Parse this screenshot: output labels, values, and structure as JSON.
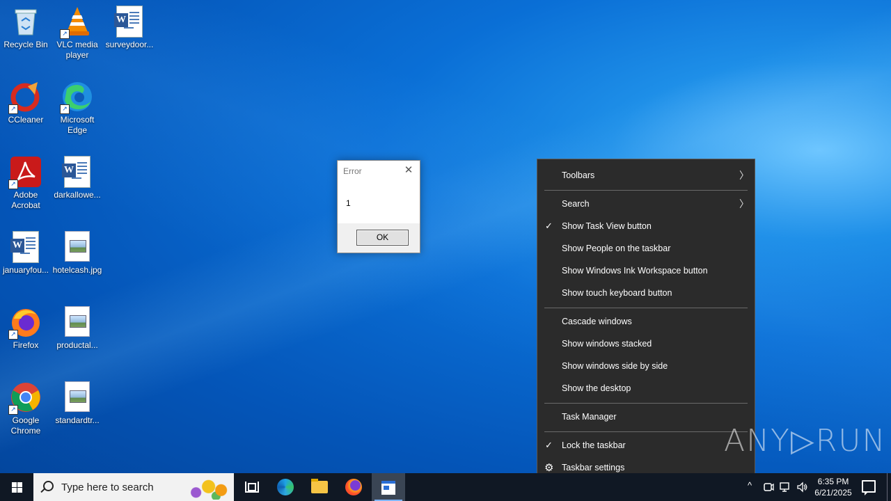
{
  "desktop_icons": [
    {
      "label": "Recycle Bin",
      "icon": "recycle-bin-icon"
    },
    {
      "label": "VLC media player",
      "icon": "vlc-icon"
    },
    {
      "label": "surveydoor...",
      "icon": "word-document-icon"
    },
    {
      "label": "CCleaner",
      "icon": "ccleaner-icon"
    },
    {
      "label": "Microsoft Edge",
      "icon": "edge-icon"
    },
    {
      "label": "Adobe Acrobat",
      "icon": "acrobat-icon"
    },
    {
      "label": "darkallowe...",
      "icon": "word-document-icon"
    },
    {
      "label": "januaryfou...",
      "icon": "word-document-icon"
    },
    {
      "label": "hotelcash.jpg",
      "icon": "image-file-icon"
    },
    {
      "label": "Firefox",
      "icon": "firefox-icon"
    },
    {
      "label": "productal...",
      "icon": "image-file-icon"
    },
    {
      "label": "Google Chrome",
      "icon": "chrome-icon"
    },
    {
      "label": "standardtr...",
      "icon": "image-file-icon"
    }
  ],
  "dialog": {
    "title": "Error",
    "close_symbol": "✕",
    "message": "1",
    "ok_label": "OK"
  },
  "context_menu": {
    "items": [
      {
        "label": "Toolbars",
        "checked": false,
        "submenu": true
      },
      {
        "label": "Search",
        "checked": false,
        "submenu": true
      },
      {
        "label": "Show Task View button",
        "checked": true,
        "submenu": false
      },
      {
        "label": "Show People on the taskbar",
        "checked": false,
        "submenu": false
      },
      {
        "label": "Show Windows Ink Workspace button",
        "checked": false,
        "submenu": false
      },
      {
        "label": "Show touch keyboard button",
        "checked": false,
        "submenu": false
      },
      {
        "label": "Cascade windows",
        "checked": false,
        "submenu": false
      },
      {
        "label": "Show windows stacked",
        "checked": false,
        "submenu": false
      },
      {
        "label": "Show windows side by side",
        "checked": false,
        "submenu": false
      },
      {
        "label": "Show the desktop",
        "checked": false,
        "submenu": false
      },
      {
        "label": "Task Manager",
        "checked": false,
        "submenu": false
      },
      {
        "label": "Lock the taskbar",
        "checked": true,
        "submenu": false
      },
      {
        "label": "Taskbar settings",
        "checked": false,
        "submenu": false,
        "icon": "gear-icon"
      }
    ],
    "check_symbol": "✓",
    "arrow_symbol": "〉"
  },
  "taskbar": {
    "search_placeholder": "Type here to search",
    "time": "6:35 PM",
    "date": "6/21/2025",
    "pinned": [
      "task-view-icon",
      "edge-icon",
      "file-explorer-icon",
      "firefox-icon",
      "active-window-icon"
    ],
    "tray_arrow": "^",
    "tray_icons": [
      "meet-now-icon",
      "network-icon",
      "volume-icon"
    ]
  },
  "watermark": "ANY▷RUN"
}
